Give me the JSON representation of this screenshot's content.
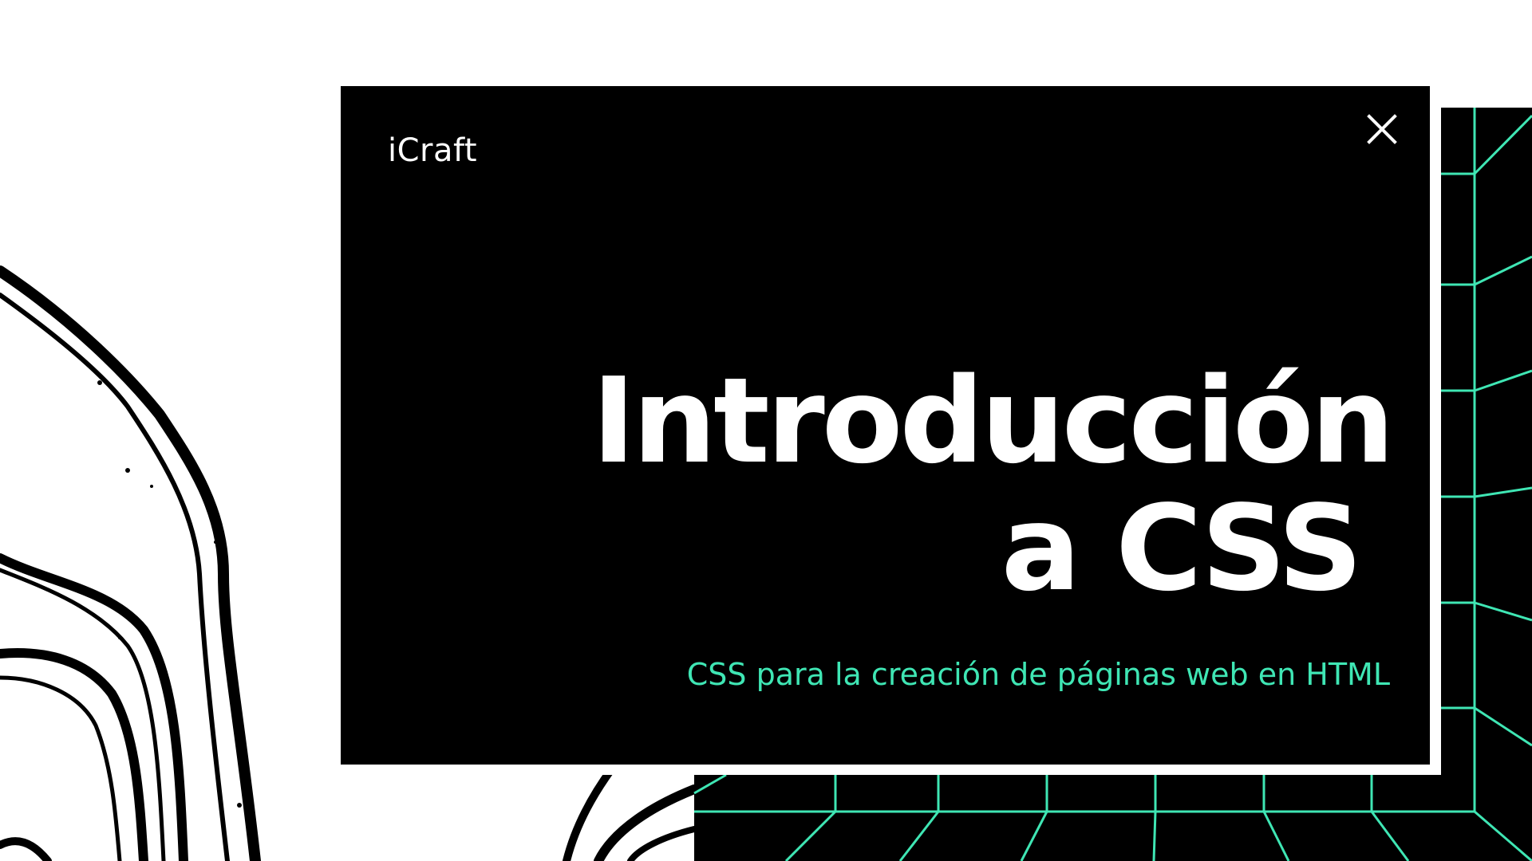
{
  "brand": {
    "name": "iCraft"
  },
  "slide": {
    "title_line1": "Introducción",
    "title_line2": "a CSS",
    "subtitle": "CSS para la creación de páginas web en HTML"
  },
  "close": {
    "icon": "close-icon",
    "label": "×"
  },
  "colors": {
    "background": "#ffffff",
    "card": "#000000",
    "title": "#ffffff",
    "accent": "#3fe6b4"
  }
}
